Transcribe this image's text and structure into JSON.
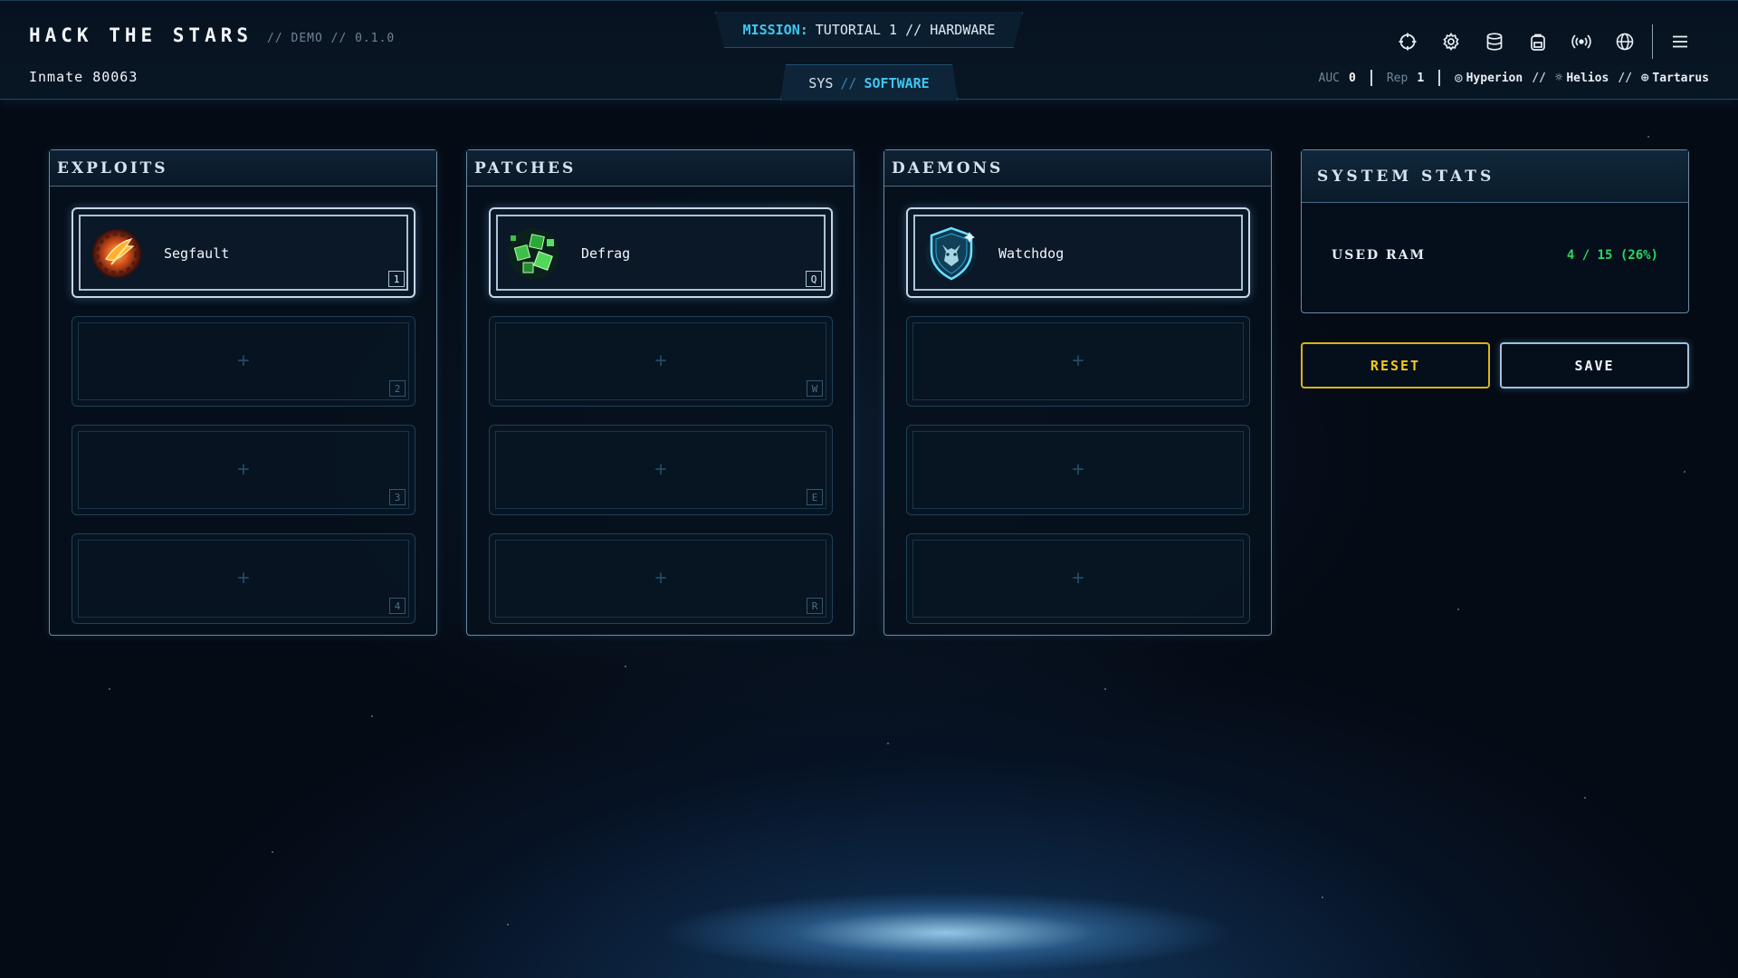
{
  "header": {
    "title": "HACK THE STARS",
    "version": "// DEMO // 0.1.0",
    "inmate": "Inmate 80063",
    "mission_label": "MISSION:",
    "mission_value": "TUTORIAL 1 // HARDWARE",
    "sys_tab": {
      "prefix": "SYS",
      "sep": "//",
      "active": "SOFTWARE"
    },
    "icons": [
      "crosshair-icon",
      "gear-icon",
      "database-icon",
      "backpack-icon",
      "broadcast-icon",
      "globe-icon",
      "menu-icon"
    ],
    "stats": {
      "auc_label": "AUC",
      "auc_value": "0",
      "rep_label": "Rep",
      "rep_value": "1",
      "systems": [
        "Hyperion",
        "Helios",
        "Tartarus"
      ],
      "sys_sep": "//"
    }
  },
  "panels": [
    {
      "title": "EXPLOITS",
      "slots": [
        {
          "item": "Segfault",
          "icon": "segfault-icon",
          "key": "1"
        },
        {
          "item": null,
          "key": "2"
        },
        {
          "item": null,
          "key": "3"
        },
        {
          "item": null,
          "key": "4"
        }
      ]
    },
    {
      "title": "PATCHES",
      "slots": [
        {
          "item": "Defrag",
          "icon": "defrag-icon",
          "key": "Q"
        },
        {
          "item": null,
          "key": "W"
        },
        {
          "item": null,
          "key": "E"
        },
        {
          "item": null,
          "key": "R"
        }
      ]
    },
    {
      "title": "DAEMONS",
      "slots": [
        {
          "item": "Watchdog",
          "icon": "watchdog-icon",
          "key": ""
        },
        {
          "item": null,
          "key": ""
        },
        {
          "item": null,
          "key": ""
        },
        {
          "item": null,
          "key": ""
        }
      ]
    }
  ],
  "system_stats": {
    "title": "SYSTEM STATS",
    "ram_label": "USED RAM",
    "ram_value": "4 / 15 (26%)"
  },
  "buttons": {
    "reset": "RESET",
    "save": "SAVE"
  },
  "colors": {
    "accent": "#3fc7f2",
    "ram_ok": "#2bd862",
    "reset": "#f2c81a",
    "border": "#6c8aa3"
  }
}
